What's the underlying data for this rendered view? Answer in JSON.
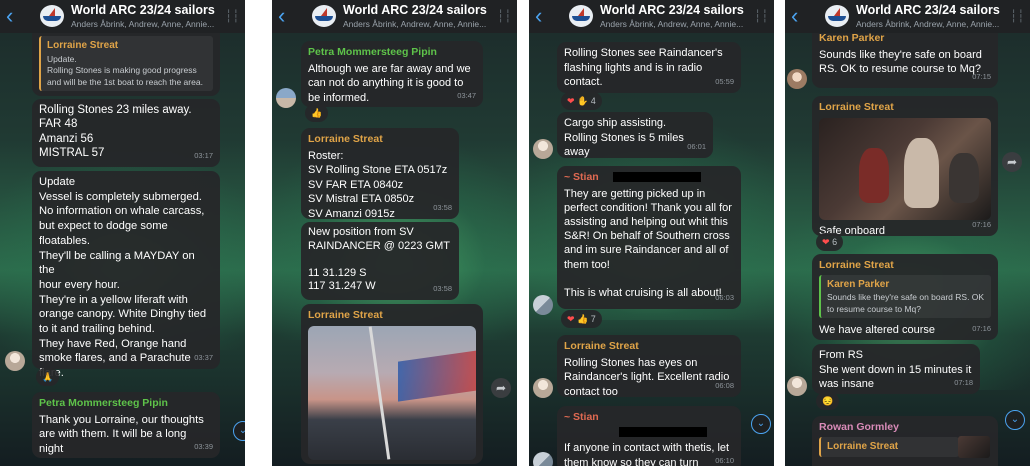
{
  "header": {
    "title": "World ARC 23/24 sailors",
    "subtitle": "Anders Åbrink, Andrew, Anne, Annie..."
  },
  "panel1": {
    "partial_sender": "Lorraine Streat",
    "msg1": {
      "sender": "Lorraine Streat",
      "quote_title": "Update.",
      "quote_text": "Rolling Stones is making good progress\nand will be the 1st boat to reach the area."
    },
    "msg2": {
      "text": "Rolling Stones 23 miles away.\nFAR 48\nAmanzi 56\nMISTRAL 57",
      "time": "03:17"
    },
    "msg3": {
      "text": "Update\nVessel is completely submerged.\nNo information on whale carcass,\nbut expect to dodge some\nfloatables.\nThey'll be calling a MAYDAY on the\nhour every hour.\nThey're in a yellow liferaft with\norange canopy. White Dinghy tied\nto it and trailing behind.\nThey have Red, Orange hand\nsmoke flares, and a Parachute\nflare.",
      "time": "03:37",
      "reaction": "🙏"
    },
    "msg4": {
      "sender": "Petra Mommersteeg Pipin",
      "text": "Thank you Lorraine, our thoughts\nare with them. It will be a long\nnight",
      "time": "03:39"
    }
  },
  "panel2": {
    "msg1": {
      "sender": "Petra Mommersteeg Pipin",
      "text": "Although we are far away and we\ncan not do anything it is good to\nbe informed.",
      "time": "03:47",
      "reaction": "👍"
    },
    "msg2": {
      "sender": "Lorraine Streat",
      "text": "Roster:\nSV Rolling Stone ETA 0517z\nSV FAR ETA 0840z\nSV Mistral ETA 0850z\nSV Amanzi 0915z",
      "time": "03:58"
    },
    "msg3": {
      "text": "New position from SV\nRAINDANCER @ 0223 GMT\n\n11 31.129 S\n117 31.247 W",
      "time": "03:58"
    },
    "msg4": {
      "sender": "Lorraine Streat"
    }
  },
  "panel3": {
    "msg1": {
      "text": "Rolling Stones see Raindancer's\nflashing lights and is in radio\ncontact.",
      "time": "05:59",
      "reaction_count": "4"
    },
    "msg2": {
      "text": "Cargo ship assisting.\nRolling Stones is 5 miles away",
      "time": "06:01"
    },
    "msg3": {
      "sender": "~ Stian",
      "text": "They are getting picked up in\nperfect condition! Thank you all for\nassisting and helping out whit this\nS&R! On behalf of Southern cross\nand im sure Raindancer and all of\nthem too!\n\nThis is what cruising is all about!",
      "time": "06:03",
      "reaction_count": "7"
    },
    "msg4": {
      "sender": "Lorraine Streat",
      "text": "Rolling Stones has eyes on\nRaindancer's light. Excellent radio\ncontact too",
      "time": "06:08"
    },
    "msg5": {
      "sender": "~ Stian",
      "text": "If anyone in contact with thetis, let\nthem know so they can turn\naround again :)",
      "time": "06:10"
    }
  },
  "panel4": {
    "msg1": {
      "sender": "Karen Parker",
      "text": "Sounds like they're safe on board\nRS. OK to resume course to Mq?",
      "time": "07:15"
    },
    "msg2": {
      "sender": "Lorraine Streat",
      "text": "Safe onboard",
      "time": "07:16",
      "reaction_count": "6"
    },
    "msg3": {
      "sender": "Lorraine Streat",
      "quote_name": "Karen Parker",
      "quote_text": "Sounds like they're safe on board RS. OK\nto resume course to Mq?",
      "text": "We have altered course",
      "time": "07:16"
    },
    "msg4": {
      "text": "From RS\nShe went down in 15 minutes it\nwas insane",
      "time": "07:18",
      "reaction": "😔"
    },
    "msg5": {
      "sender": "Rowan Gormley",
      "quote_name": "Lorraine Streat"
    }
  },
  "icons": {
    "back": "chevron-left-icon",
    "share": "share-icon",
    "scroll_down": "chevron-down-icon",
    "voice": "voice-bars-icon"
  },
  "colors": {
    "accent_blue": "#4ba3f0",
    "sender_orange": "#e0a448",
    "sender_green": "#5ec34a",
    "sender_red": "#e06a52",
    "bubble_bg": "#262729"
  }
}
